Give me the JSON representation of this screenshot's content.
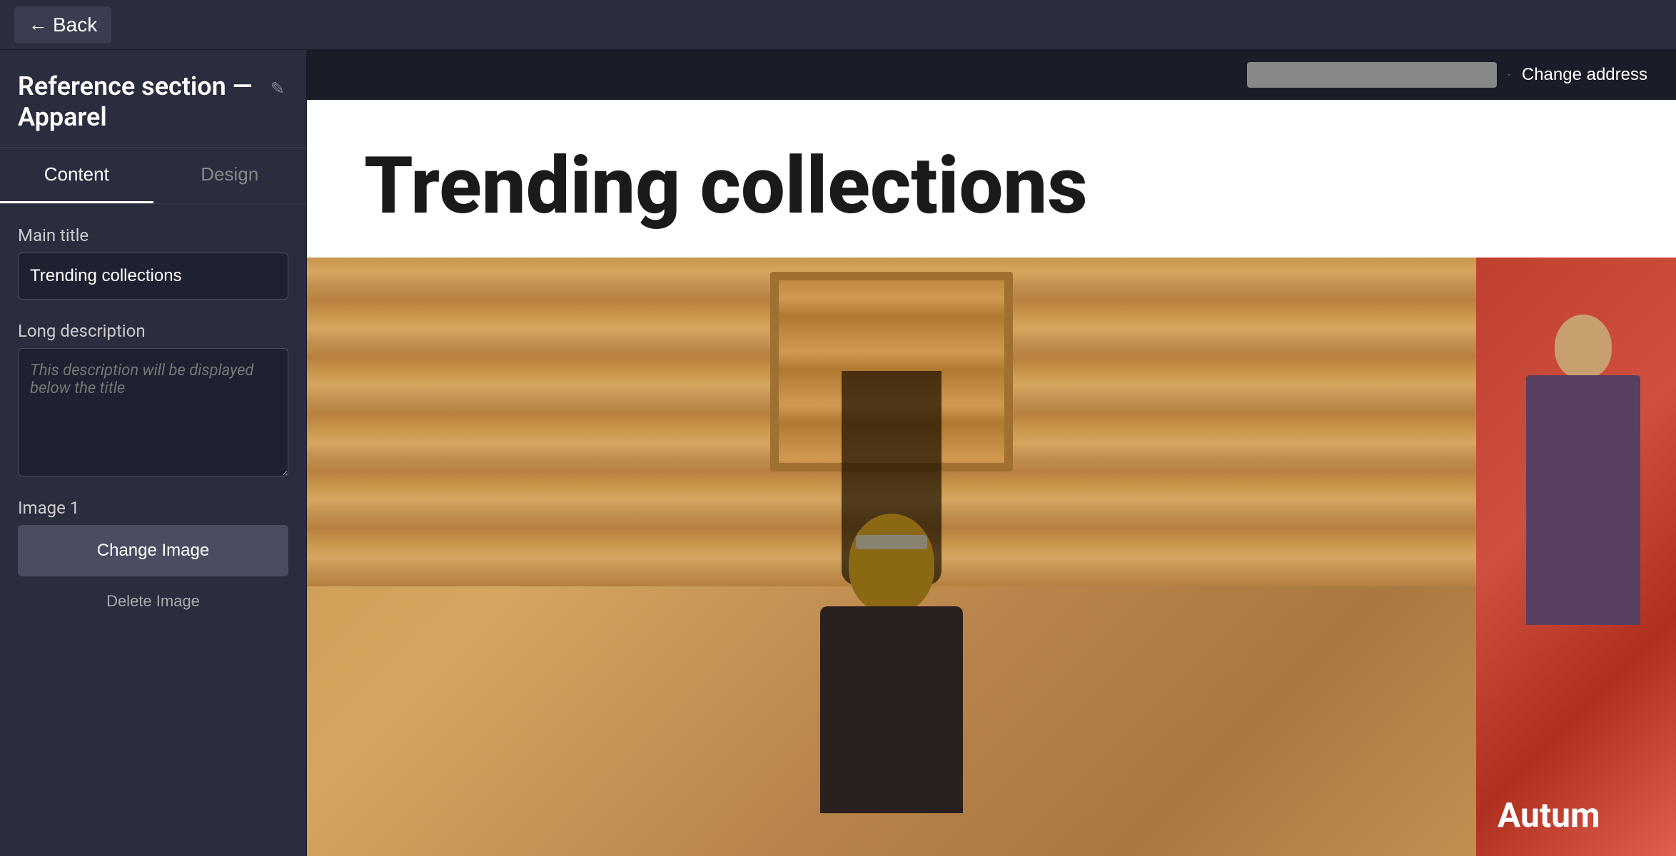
{
  "topbar": {
    "back_label": "Back"
  },
  "sidebar": {
    "section_title": "Reference section — Apparel",
    "tabs": [
      {
        "id": "content",
        "label": "Content",
        "active": true
      },
      {
        "id": "design",
        "label": "Design",
        "active": false
      }
    ],
    "fields": {
      "main_title_label": "Main title",
      "main_title_value": "Trending collections",
      "long_description_label": "Long description",
      "long_description_placeholder": "This description will be displayed below the title",
      "image1_label": "Image 1",
      "change_image_label": "Change Image",
      "delete_image_label": "Delete Image"
    }
  },
  "preview": {
    "change_address_label": "Change address",
    "main_title": "Trending collections",
    "secondary_image_text": "Autum"
  },
  "icons": {
    "back_arrow": "←",
    "edit_pencil": "✎"
  }
}
